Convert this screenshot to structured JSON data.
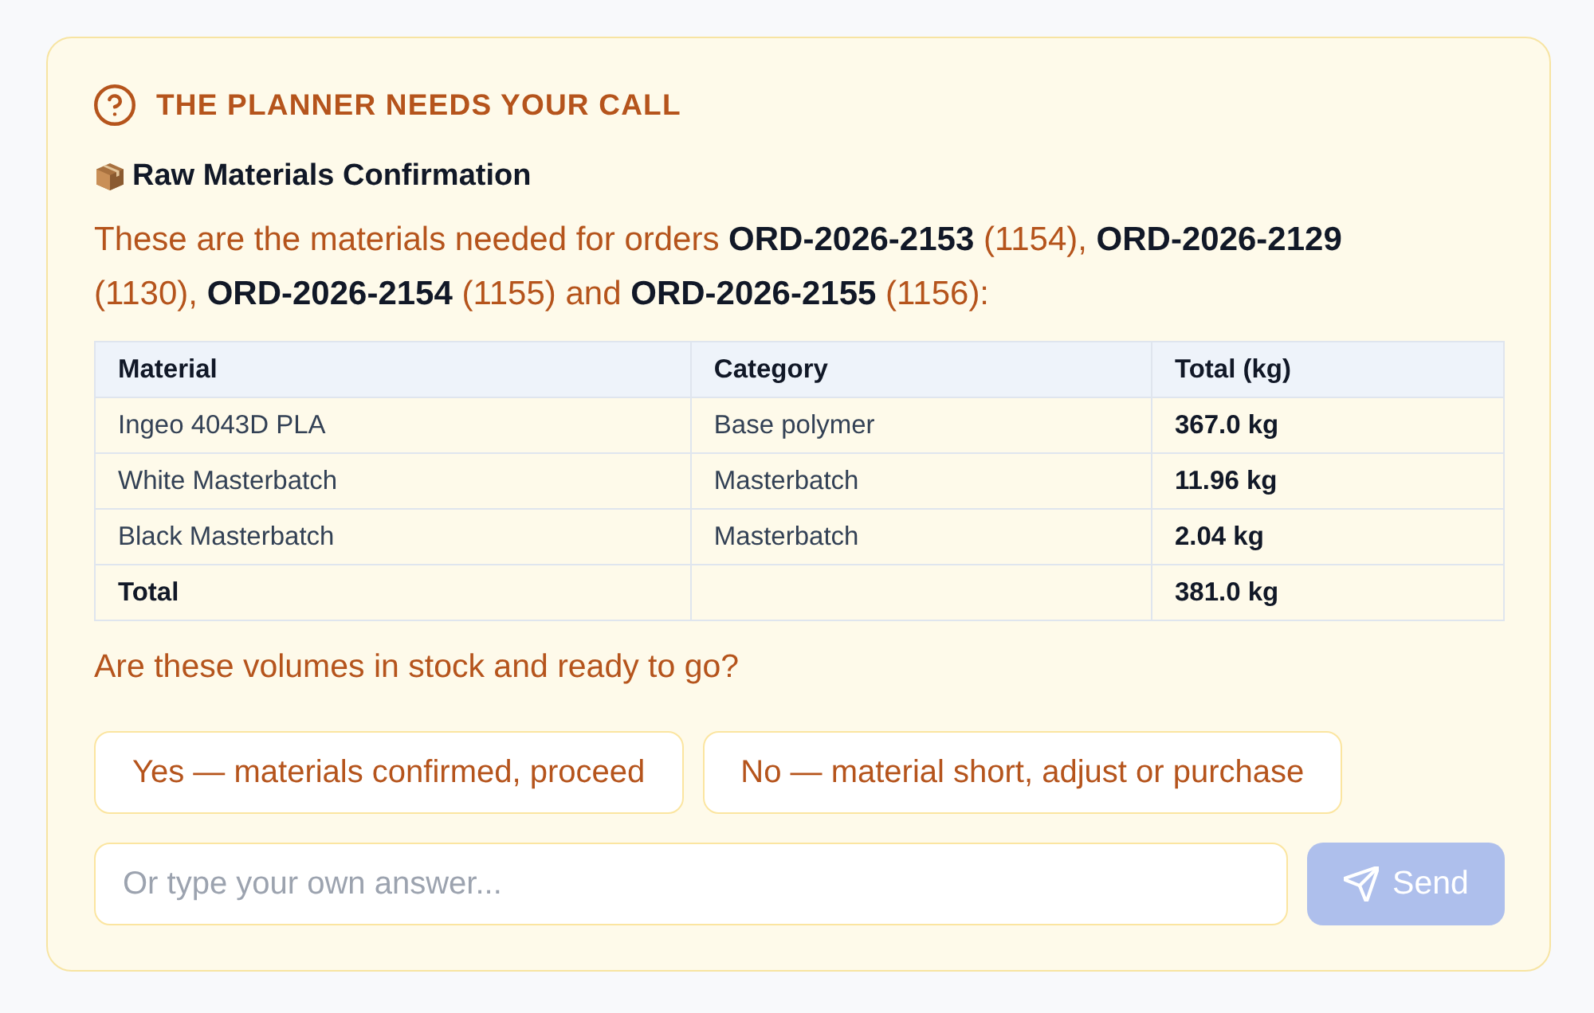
{
  "heading": "THE PLANNER NEEDS YOUR CALL",
  "title": "Raw Materials Confirmation",
  "intro": "These are the materials needed for orders **ORD-2026-2153** (1154), **ORD-2026-2129** (1130), **ORD-2026-2154** (1155) and **ORD-2026-2155** (1156):",
  "table": {
    "columns": [
      "Material",
      "Category",
      "Total (kg)"
    ],
    "rows": [
      {
        "kind": "item",
        "material": "Ingeo 4043D PLA",
        "category": "Base polymer",
        "total": "367.0 kg"
      },
      {
        "kind": "item",
        "material": "White Masterbatch",
        "category": "Masterbatch",
        "total": "11.96 kg"
      },
      {
        "kind": "item",
        "material": "Black Masterbatch",
        "category": "Masterbatch",
        "total": "2.04 kg"
      },
      {
        "kind": "total",
        "material": "Total",
        "total": "381.0 kg"
      }
    ]
  },
  "question": "Are these volumes in stock and ready to go?",
  "options": [
    "Yes — materials confirmed, proceed",
    "No — material short, adjust or purchase"
  ],
  "answer": {
    "placeholder": "Or type your own answer..."
  },
  "send": {
    "label": "Send",
    "disabled": true
  }
}
